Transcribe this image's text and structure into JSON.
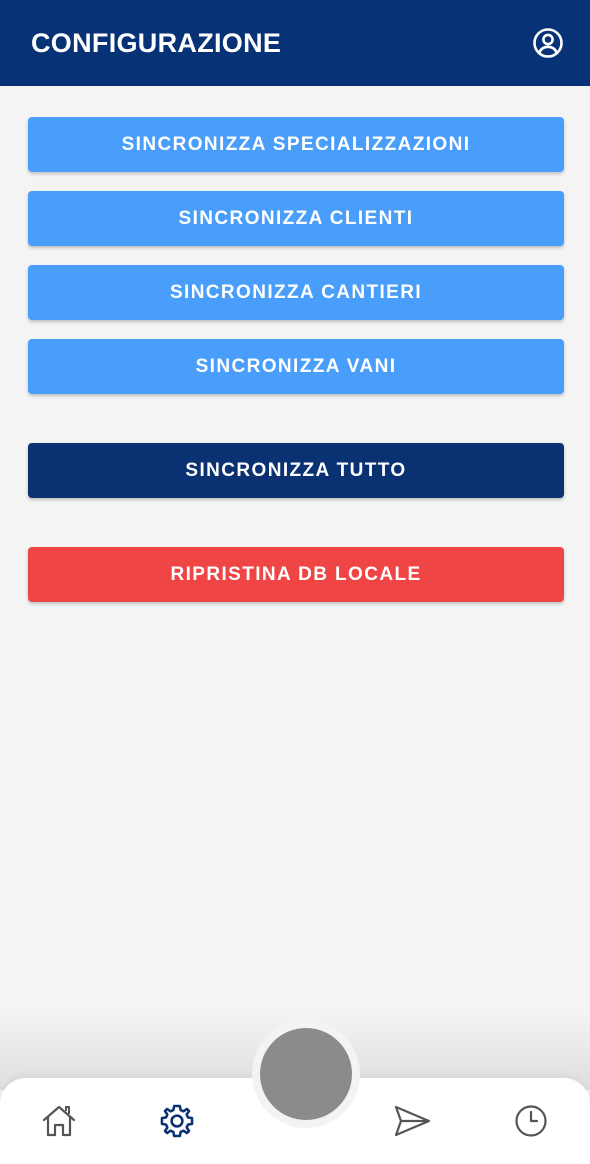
{
  "header": {
    "title": "CONFIGURAZIONE",
    "user_icon": "user-circle-icon",
    "background": "#073275"
  },
  "actions": {
    "sync_specializations": "SINCRONIZZA SPECIALIZZAZIONI",
    "sync_clients": "SINCRONIZZA CLIENTI",
    "sync_sites": "SINCRONIZZA CANTIERI",
    "sync_rooms": "SINCRONIZZA VANI",
    "sync_all": "SINCRONIZZA TUTTO",
    "reset_local_db": "RIPRISTINA DB LOCALE"
  },
  "colors": {
    "primary_light": "#4a9efb",
    "primary_dark": "#0a3272",
    "danger": "#ef4545",
    "nav_active": "#0a3272",
    "nav_inactive": "#555555",
    "fab": "#8b8b8b"
  },
  "nav": {
    "items": [
      {
        "icon": "home-icon",
        "active": false
      },
      {
        "icon": "gear-icon",
        "active": true
      },
      {
        "icon": "camera-fab",
        "active": false
      },
      {
        "icon": "send-icon",
        "active": false
      },
      {
        "icon": "clock-icon",
        "active": false
      }
    ]
  }
}
